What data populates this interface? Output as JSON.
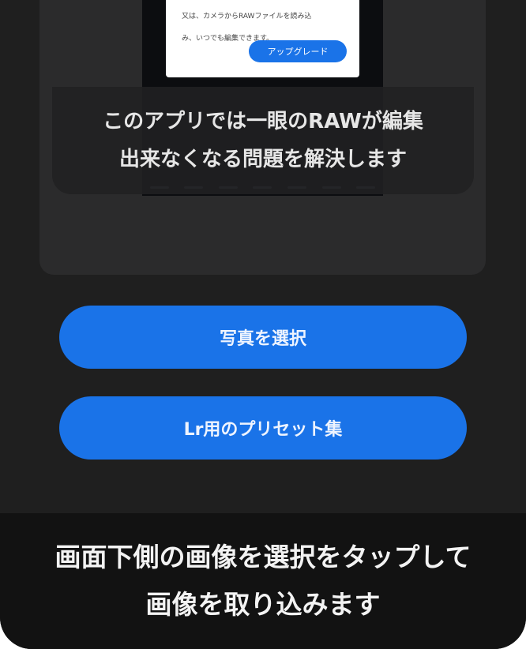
{
  "preview": {
    "dialog": {
      "line1": "又は、カメラからRAWファイルを読み込",
      "line2": "み、いつでも編集できます。",
      "upgrade_label": "アップグレード"
    },
    "caption": {
      "line1": "このアプリでは一眼のRAWが編集",
      "line2": "出来なくなる問題を解決します"
    }
  },
  "buttons": {
    "select_photo": "写真を選択",
    "lr_presets": "Lr用のプリセット集"
  },
  "instruction": {
    "line1": "画面下側の画像を選択をタップして",
    "line2": "画像を取り込みます"
  },
  "colors": {
    "accent": "#1a73e8",
    "background": "#1f1f1f",
    "panel": "#121212"
  }
}
